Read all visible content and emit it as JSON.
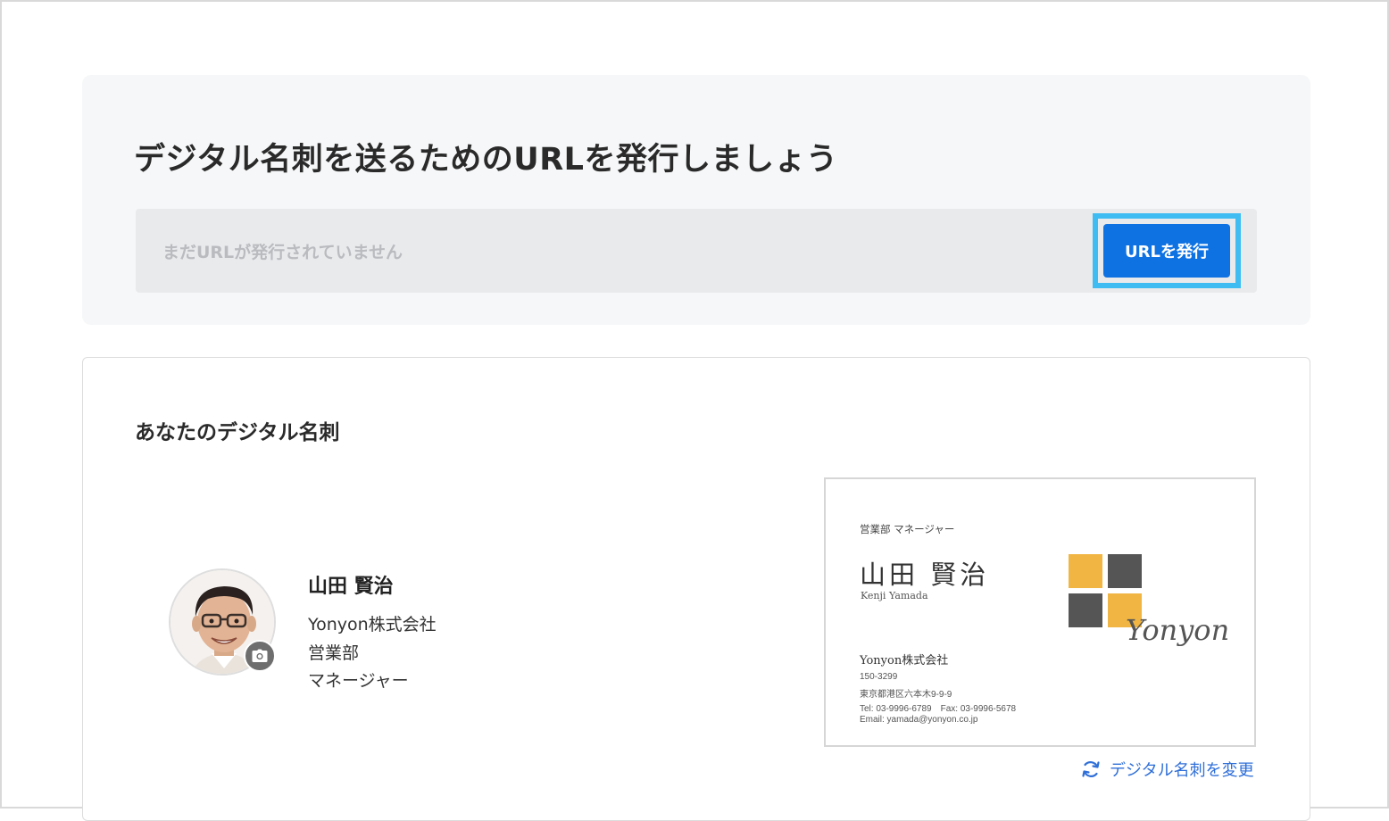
{
  "url_section": {
    "title": "デジタル名刺を送るためのURLを発行しましょう",
    "placeholder": "まだURLが発行されていません",
    "issue_button": "URLを発行"
  },
  "card_section": {
    "heading": "あなたのデジタル名刺",
    "profile": {
      "name": "山田 賢治",
      "company": "Yonyon株式会社",
      "department": "営業部",
      "position": "マネージャー"
    },
    "business_card": {
      "title": "営業部 マネージャー",
      "name": "山田 賢治",
      "roman_name": "Kenji Yamada",
      "company": "Yonyon株式会社",
      "postal": "150-3299",
      "address": "東京都港区六本木9-9-9",
      "tel_fax": "Tel: 03-9996-6789　Fax: 03-9996-5678",
      "email": "Email: yamada@yonyon.co.jp",
      "logo_text": "Yonyon",
      "logo_colors": [
        "#f0b542",
        "#555555"
      ]
    },
    "change_link": "デジタル名刺を変更",
    "icons": {
      "camera": "camera-icon",
      "change": "refresh-icon"
    }
  },
  "colors": {
    "primary_button": "#0f72e3",
    "highlight": "#3fbdf2",
    "link": "#2f6fd8"
  }
}
